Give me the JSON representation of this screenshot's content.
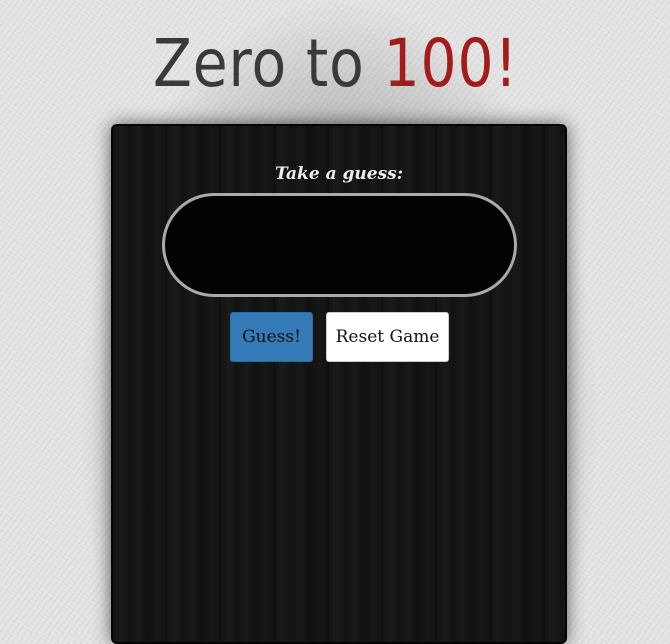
{
  "header": {
    "title_main": "Zero to ",
    "title_accent": "100",
    "title_end": "!"
  },
  "game": {
    "prompt": "Take a guess:",
    "guess_input": {
      "value": "",
      "placeholder": ""
    },
    "guess_button_label": "Guess!",
    "reset_button_label": "Reset Game"
  },
  "colors": {
    "title": "#3a3a3a",
    "title_accent": "#a31c1c",
    "guess_button": "#337ab7",
    "board": "#111111"
  }
}
